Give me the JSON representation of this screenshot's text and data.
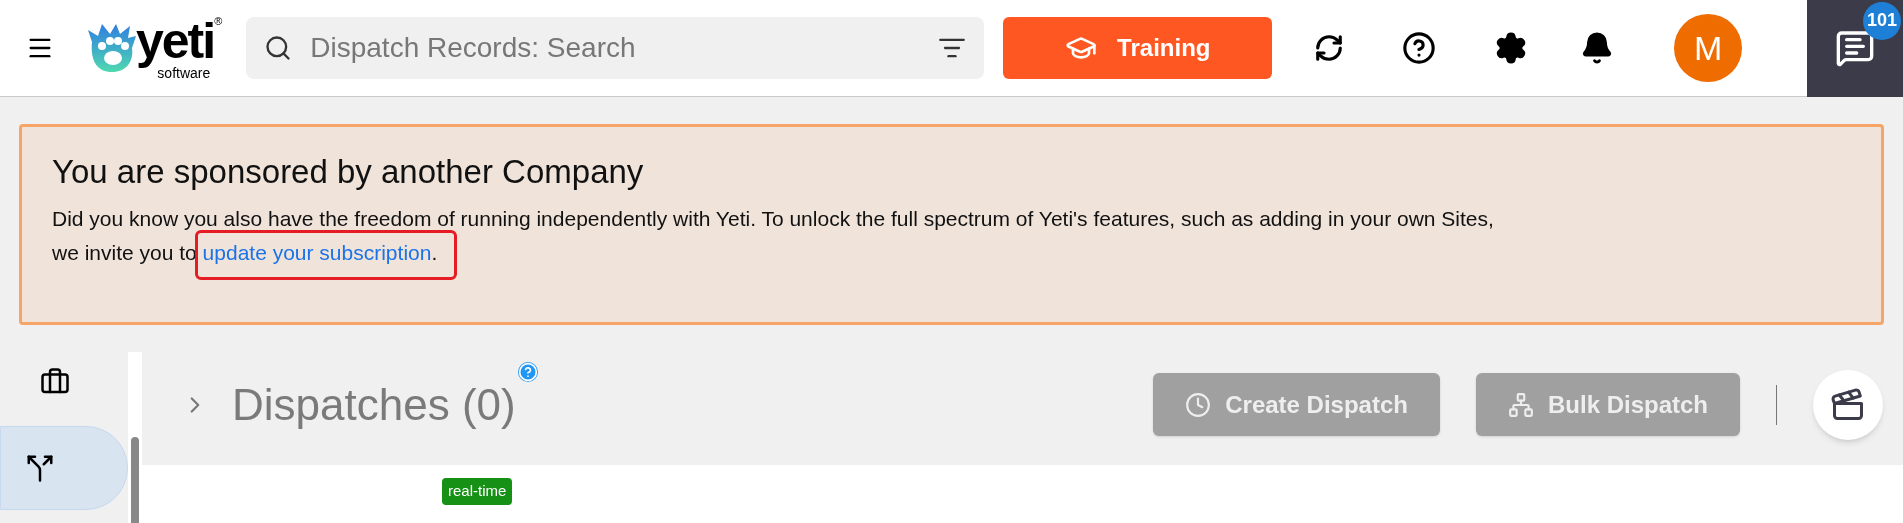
{
  "topbar": {
    "logo": {
      "word": "yeti",
      "sub": "software",
      "mark": "®"
    },
    "search": {
      "placeholder": "Dispatch Records: Search"
    },
    "training_button": "Training",
    "avatar": "M",
    "chat_badge": "101"
  },
  "banner": {
    "title": "You are sponsored by another Company",
    "text_before": "Did you know you also have the freedom of running independently with Yeti. To unlock the full spectrum of Yeti's features, such as adding in your own Sites, we invite you to",
    "link": "update your subscription",
    "text_after": ".",
    "highlighted": true
  },
  "sidebar": {
    "items": [
      {
        "kind": "briefcase",
        "selected": false
      },
      {
        "kind": "dispatch",
        "selected": true
      }
    ]
  },
  "page": {
    "title": "Dispatches (0)",
    "expanded": false,
    "buttons": [
      {
        "label": "Create Dispatch",
        "kind": "create",
        "disabled": true
      },
      {
        "label": "Bulk Dispatch",
        "kind": "bulk",
        "disabled": true
      }
    ],
    "card_badge": "real-time"
  }
}
